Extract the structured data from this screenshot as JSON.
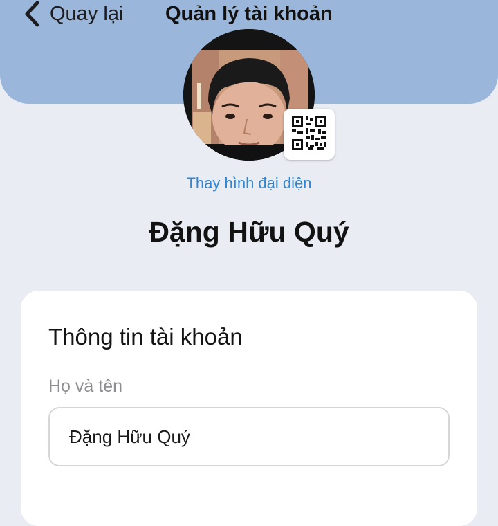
{
  "header": {
    "back_label": "Quay lại",
    "title": "Quản lý tài khoản",
    "background_color": "#9ab6da",
    "back_icon": "chevron-left-icon"
  },
  "profile": {
    "change_avatar_label": "Thay hình đại diện",
    "name": "Đặng Hữu Quý",
    "qr_icon": "qr-code-icon",
    "link_color": "#2f86d3"
  },
  "account_card": {
    "title": "Thông tin tài khoản",
    "full_name_label": "Họ và tên",
    "full_name_value": "Đặng Hữu Quý"
  }
}
